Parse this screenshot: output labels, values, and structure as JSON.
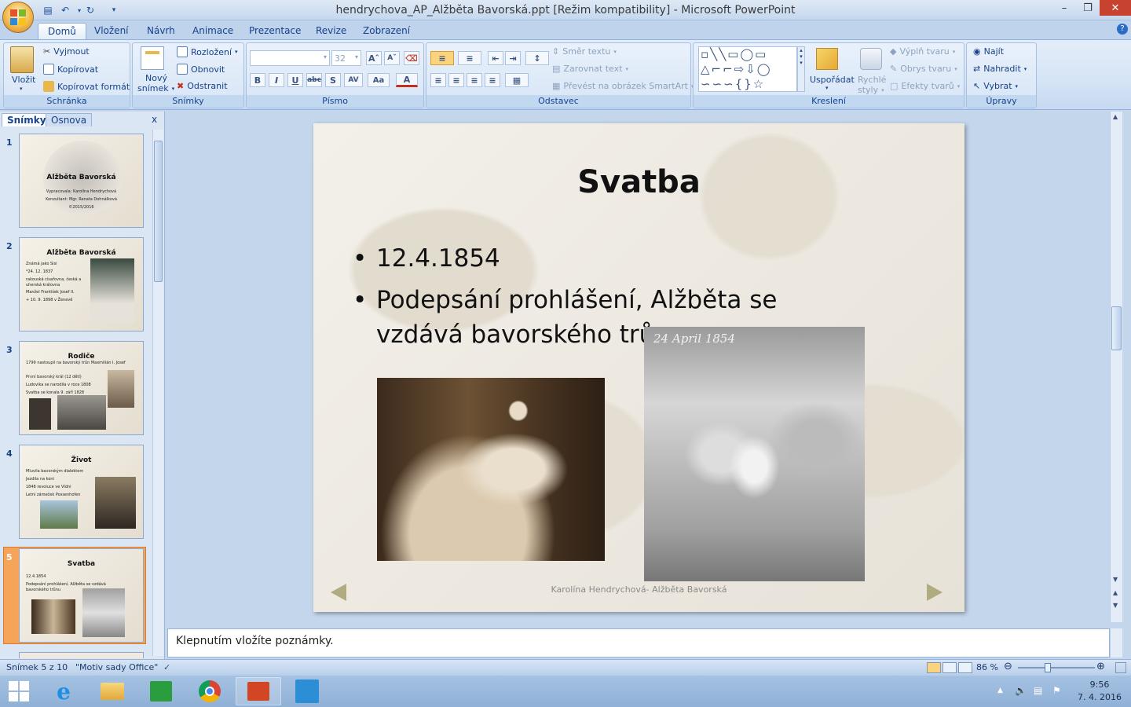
{
  "window": {
    "title": "hendrychova_AP_Alžběta Bavorská.ppt [Režim kompatibility] - Microsoft PowerPoint"
  },
  "tabs": [
    "Domů",
    "Vložení",
    "Návrh",
    "Animace",
    "Prezentace",
    "Revize",
    "Zobrazení"
  ],
  "ribbon": {
    "schranka": {
      "label": "Schránka",
      "paste": "Vložit",
      "cut": "Vyjmout",
      "copy": "Kopírovat",
      "format_painter": "Kopírovat formát"
    },
    "snimky": {
      "label": "Snímky",
      "new_slide_1": "Nový",
      "new_slide_2": "snímek",
      "layout": "Rozložení",
      "reset": "Obnovit",
      "delete": "Odstranit"
    },
    "pismo": {
      "label": "Písmo",
      "font_size": "32",
      "font_name": ""
    },
    "odstavec": {
      "label": "Odstavec",
      "text_direction": "Směr textu",
      "align_text": "Zarovnat text",
      "smartart": "Převést na obrázek SmartArt"
    },
    "kresleni": {
      "label": "Kreslení",
      "arrange": "Uspořádat",
      "quick_styles_1": "Rychlé",
      "quick_styles_2": "styly",
      "fill": "Výplň tvaru",
      "outline": "Obrys tvaru",
      "effects": "Efekty tvarů"
    },
    "upravy": {
      "label": "Úpravy",
      "find": "Najít",
      "replace": "Nahradit",
      "select": "Vybrat"
    }
  },
  "leftpane": {
    "tab_slides": "Snímky",
    "tab_outline": "Osnova",
    "close": "x"
  },
  "thumbnails": [
    {
      "num": "1",
      "title": "Alžběta Bavorská",
      "lines": [
        "Vypracovala: Karolína Hendrychová",
        "Konzultant: Mgr. Renata Dohnálková",
        "©2015/2016"
      ]
    },
    {
      "num": "2",
      "title": "Alžběta Bavorská",
      "lines": [
        "Známá jako Sisi",
        "*24. 12. 1837",
        "rakouská císařovna, česká a uherská královna",
        "Manžel František Josef II.",
        "+ 10. 9. 1898 v Ženevě"
      ]
    },
    {
      "num": "3",
      "title": "Rodiče",
      "lines": [
        "1799 nastoupil na bavorský trůn Maxmilián I. Josef",
        "První bavorský král (12 dětí)",
        "Ludovika se narodila v roce 1808",
        "Svatba se konala 9. září 1828"
      ]
    },
    {
      "num": "4",
      "title": "Život",
      "lines": [
        "Mluvila bavorským dialektem",
        "Jezdila na koni",
        "1848 revoluce ve Vídni",
        "Letní zámeček Possenhofen"
      ]
    },
    {
      "num": "5",
      "title": "Svatba",
      "lines": [
        "12.4.1854",
        "Podepsání prohlášení, Alžběta se vzdává bavorského trůnu"
      ]
    }
  ],
  "slide": {
    "title": "Svatba",
    "bullets": [
      "12.4.1854",
      "Podepsání prohlášení, Alžběta se vzdává bavorského trůnu"
    ],
    "image_caption": "24 April 1854",
    "footer": "Karolína Hendrychová- Alžběta Bavorská"
  },
  "notes": {
    "placeholder": "Klepnutím vložíte poznámky."
  },
  "status": {
    "slide": "Snímek 5 z 10",
    "theme": "\"Motiv sady Office\"",
    "zoom": "86 %"
  },
  "taskbar": {
    "time": "9:56",
    "date": "7. 4. 2016"
  }
}
